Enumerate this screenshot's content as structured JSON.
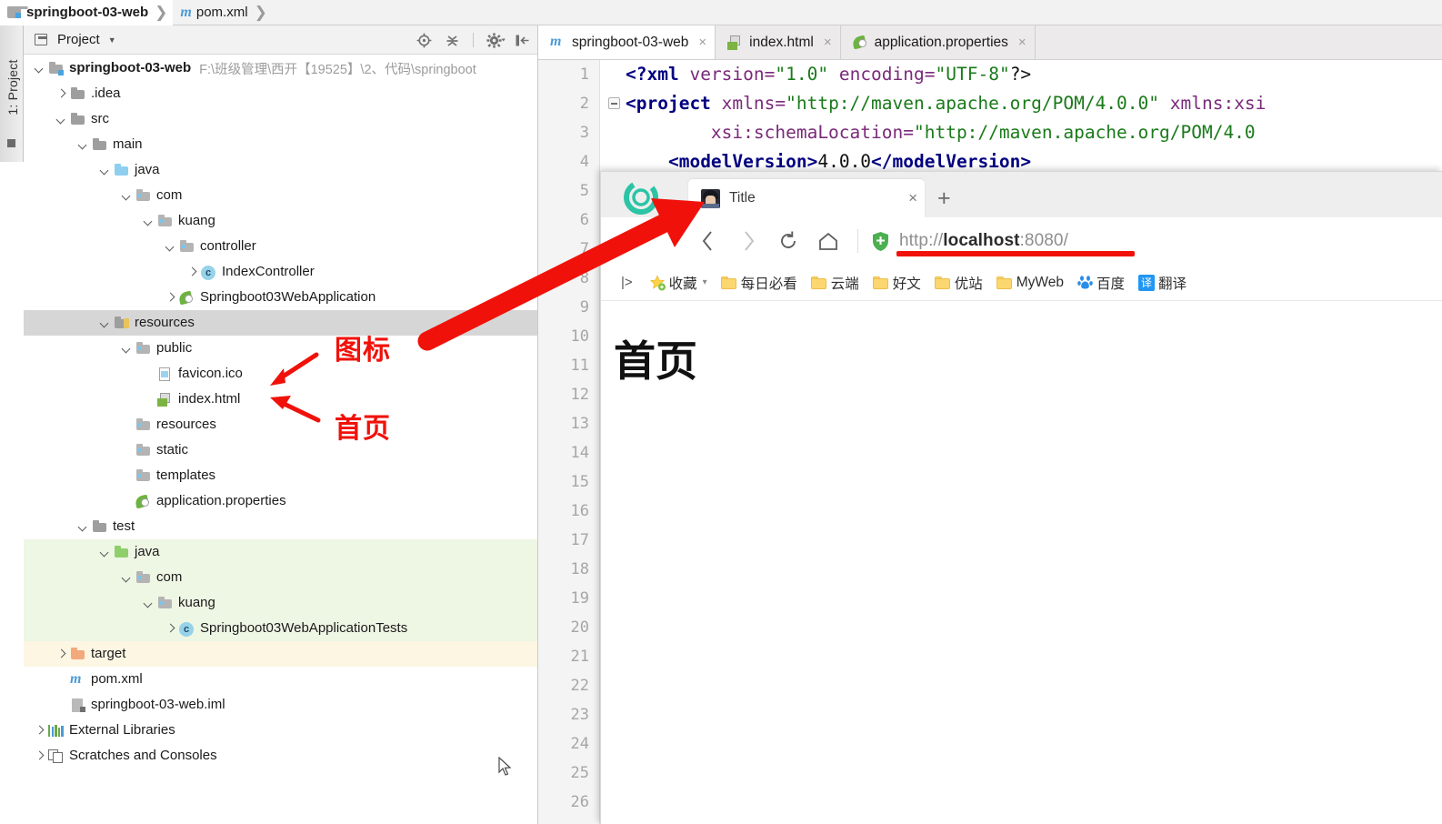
{
  "ide": {
    "breadcrumb": [
      {
        "label": "springboot-03-web",
        "icon": "module-icon"
      },
      {
        "label": "pom.xml",
        "icon": "maven-icon"
      }
    ],
    "tool_tab_label": "1: Project",
    "project_panel": {
      "title": "Project",
      "tools": [
        "locate-icon",
        "collapse-all-icon",
        "settings-gear-icon",
        "hide-panel-icon"
      ]
    },
    "tree": [
      {
        "label": "springboot-03-web",
        "path": "F:\\班级管理\\西开【19525】\\2、代码\\springboot",
        "indent": 0,
        "arrow": "down",
        "icon": "module-icon",
        "bold": true,
        "state": ""
      },
      {
        "label": ".idea",
        "path": "",
        "indent": 1,
        "arrow": "right",
        "icon": "folder-grey",
        "bold": false,
        "state": ""
      },
      {
        "label": "src",
        "path": "",
        "indent": 1,
        "arrow": "down",
        "icon": "folder-grey",
        "bold": false,
        "state": ""
      },
      {
        "label": "main",
        "path": "",
        "indent": 2,
        "arrow": "down",
        "icon": "folder-grey",
        "bold": false,
        "state": ""
      },
      {
        "label": "java",
        "path": "",
        "indent": 3,
        "arrow": "down",
        "icon": "folder-blue",
        "bold": false,
        "state": ""
      },
      {
        "label": "com",
        "path": "",
        "indent": 4,
        "arrow": "down",
        "icon": "folder-package",
        "bold": false,
        "state": ""
      },
      {
        "label": "kuang",
        "path": "",
        "indent": 5,
        "arrow": "down",
        "icon": "folder-package",
        "bold": false,
        "state": ""
      },
      {
        "label": "controller",
        "path": "",
        "indent": 6,
        "arrow": "down",
        "icon": "folder-package",
        "bold": false,
        "state": ""
      },
      {
        "label": "IndexController",
        "path": "",
        "indent": 7,
        "arrow": "right",
        "icon": "class-icon",
        "bold": false,
        "state": ""
      },
      {
        "label": "Springboot03WebApplication",
        "path": "",
        "indent": 6,
        "arrow": "right",
        "icon": "spring-icon",
        "bold": false,
        "state": ""
      },
      {
        "label": "resources",
        "path": "",
        "indent": 3,
        "arrow": "down",
        "icon": "folder-resources",
        "bold": false,
        "state": "selected"
      },
      {
        "label": "public",
        "path": "",
        "indent": 4,
        "arrow": "down",
        "icon": "folder-package",
        "bold": false,
        "state": ""
      },
      {
        "label": "favicon.ico",
        "path": "",
        "indent": 5,
        "arrow": "none",
        "icon": "ico-file-icon",
        "bold": false,
        "state": ""
      },
      {
        "label": "index.html",
        "path": "",
        "indent": 5,
        "arrow": "none",
        "icon": "html-file-icon",
        "bold": false,
        "state": ""
      },
      {
        "label": "resources",
        "path": "",
        "indent": 4,
        "arrow": "none",
        "icon": "folder-package",
        "bold": false,
        "state": ""
      },
      {
        "label": "static",
        "path": "",
        "indent": 4,
        "arrow": "none",
        "icon": "folder-package",
        "bold": false,
        "state": ""
      },
      {
        "label": "templates",
        "path": "",
        "indent": 4,
        "arrow": "none",
        "icon": "folder-package",
        "bold": false,
        "state": ""
      },
      {
        "label": "application.properties",
        "path": "",
        "indent": 4,
        "arrow": "none",
        "icon": "spring-icon",
        "bold": false,
        "state": ""
      },
      {
        "label": "test",
        "path": "",
        "indent": 2,
        "arrow": "down",
        "icon": "folder-grey",
        "bold": false,
        "state": ""
      },
      {
        "label": "java",
        "path": "",
        "indent": 3,
        "arrow": "down",
        "icon": "folder-green",
        "bold": false,
        "state": "test"
      },
      {
        "label": "com",
        "path": "",
        "indent": 4,
        "arrow": "down",
        "icon": "folder-package",
        "bold": false,
        "state": "test"
      },
      {
        "label": "kuang",
        "path": "",
        "indent": 5,
        "arrow": "down",
        "icon": "folder-package",
        "bold": false,
        "state": "test"
      },
      {
        "label": "Springboot03WebApplicationTests",
        "path": "",
        "indent": 6,
        "arrow": "right",
        "icon": "class-icon",
        "bold": false,
        "state": "test"
      },
      {
        "label": "target",
        "path": "",
        "indent": 1,
        "arrow": "right",
        "icon": "folder-orange",
        "bold": false,
        "state": "target"
      },
      {
        "label": "pom.xml",
        "path": "",
        "indent": 1,
        "arrow": "none",
        "icon": "maven-icon",
        "bold": false,
        "state": ""
      },
      {
        "label": "springboot-03-web.iml",
        "path": "",
        "indent": 1,
        "arrow": "none",
        "icon": "iml-file-icon",
        "bold": false,
        "state": ""
      },
      {
        "label": "External Libraries",
        "path": "",
        "indent": 0,
        "arrow": "right",
        "icon": "libraries-icon",
        "bold": false,
        "state": ""
      },
      {
        "label": "Scratches and Consoles",
        "path": "",
        "indent": 0,
        "arrow": "right",
        "icon": "scratches-icon",
        "bold": false,
        "state": ""
      }
    ],
    "editor": {
      "tabs": [
        {
          "label": "springboot-03-web",
          "icon": "maven-icon",
          "active": true
        },
        {
          "label": "index.html",
          "icon": "html-file-icon",
          "active": false
        },
        {
          "label": "application.properties",
          "icon": "spring-icon",
          "active": false
        }
      ],
      "line_numbers": [
        1,
        2,
        3,
        4,
        5,
        6,
        7,
        8,
        9,
        10,
        11,
        12,
        13,
        14,
        15,
        16,
        17,
        18,
        19,
        20,
        21,
        22,
        23,
        24,
        25,
        26
      ],
      "lines": [
        {
          "n": 1,
          "segments": [
            {
              "t": "<?",
              "c": "tag"
            },
            {
              "t": "xml",
              "c": "tag"
            },
            {
              "t": " version=",
              "c": "attr"
            },
            {
              "t": "\"1.0\"",
              "c": "val"
            },
            {
              "t": " encoding=",
              "c": "attr"
            },
            {
              "t": "\"UTF-8\"",
              "c": "val"
            },
            {
              "t": "?>",
              "c": "txt"
            }
          ]
        },
        {
          "n": 2,
          "segments": [
            {
              "t": "<project",
              "c": "tag"
            },
            {
              "t": " xmlns=",
              "c": "attr"
            },
            {
              "t": "\"http://maven.apache.org/POM/4.0.0\"",
              "c": "val"
            },
            {
              "t": " xmlns:xsi",
              "c": "attr"
            }
          ]
        },
        {
          "n": 3,
          "segments": [
            {
              "t": "        ",
              "c": "txt"
            },
            {
              "t": "xsi:schemaLocation=",
              "c": "attr"
            },
            {
              "t": "\"http://maven.apache.org/POM/4.0",
              "c": "val"
            }
          ]
        },
        {
          "n": 4,
          "segments": [
            {
              "t": "    ",
              "c": "txt"
            },
            {
              "t": "<modelVersion>",
              "c": "tag"
            },
            {
              "t": "4.0.0",
              "c": "txt"
            },
            {
              "t": "</modelVersion>",
              "c": "tag"
            }
          ]
        }
      ]
    }
  },
  "browser": {
    "logo": "browser-logo-icon",
    "tab": {
      "title": "Title",
      "favicon": "page-favicon",
      "close": "×"
    },
    "new_tab": "+",
    "nav": {
      "back": "‹",
      "forward": "›",
      "reload": "↻",
      "home": "⌂"
    },
    "url": {
      "scheme": "http://",
      "host": "localhost",
      "rest": ":8080/",
      "full": "http://localhost:8080/",
      "security_icon": "shield-icon"
    },
    "bookmarks": [
      {
        "label": "收藏",
        "icon": "star-icon",
        "caret": true
      },
      {
        "label": "每日必看",
        "icon": "folder-icon",
        "caret": false
      },
      {
        "label": "云端",
        "icon": "folder-icon",
        "caret": false
      },
      {
        "label": "好文",
        "icon": "folder-icon",
        "caret": false
      },
      {
        "label": "优站",
        "icon": "folder-icon",
        "caret": false
      },
      {
        "label": "MyWeb",
        "icon": "folder-icon",
        "caret": false
      },
      {
        "label": "百度",
        "icon": "baidu-icon",
        "caret": false
      },
      {
        "label": "翻译",
        "icon": "translate-icon",
        "caret": false
      }
    ],
    "bookmarks_toggle": "|>",
    "page": {
      "heading": "首页"
    }
  },
  "annotations": {
    "icon_label": "图标",
    "home_label": "首页",
    "accent_color": "#f0120a"
  }
}
